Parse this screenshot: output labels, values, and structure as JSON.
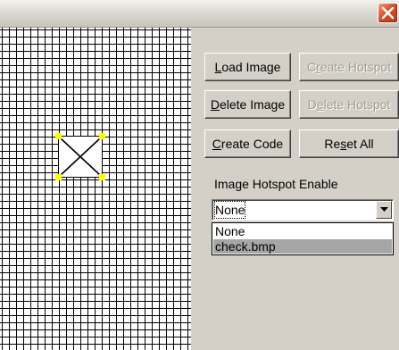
{
  "window": {
    "close_icon": "close-icon"
  },
  "toolbar": {
    "load_image": {
      "pre": "",
      "key": "L",
      "post": "oad Image",
      "enabled": true
    },
    "create_hotspot": {
      "pre": "C",
      "key": "r",
      "post": "eate Hotspot",
      "enabled": false
    },
    "delete_image": {
      "pre": "",
      "key": "D",
      "post": "elete Image",
      "enabled": true
    },
    "delete_hotspot": {
      "pre": "D",
      "key": "e",
      "post": "lete Hotspot",
      "enabled": false
    },
    "create_code": {
      "pre": "",
      "key": "C",
      "post": "reate Code",
      "enabled": true
    },
    "reset_all": {
      "pre": "Re",
      "key": "s",
      "post": "et All",
      "enabled": true
    }
  },
  "hotspot_panel": {
    "label": "Image Hotspot Enable",
    "selected_value": "None",
    "options": [
      "None",
      "check.bmp"
    ],
    "highlighted_option": "check.bmp"
  },
  "colors": {
    "grid_line": "#000000",
    "handle": "#ffff00",
    "button_face": "#d4d0c8",
    "disabled_text": "#a09c94",
    "selection": "#a6a6a6",
    "close_button": "#d8502a"
  }
}
